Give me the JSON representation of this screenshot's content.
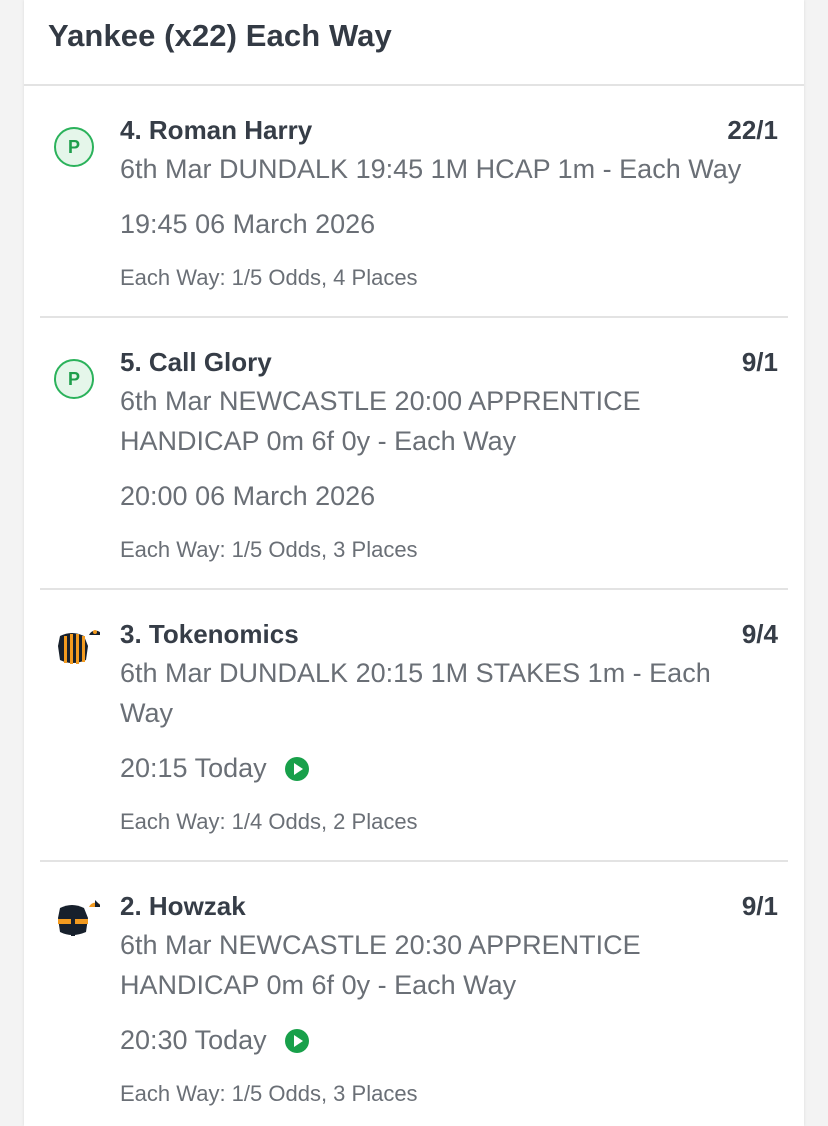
{
  "bet": {
    "title": "Yankee (x22) Each Way"
  },
  "selections": [
    {
      "runner": "4. Roman Harry",
      "odds": "22/1",
      "icon": "P",
      "event": "6th Mar DUNDALK 19:45 1M HCAP 1m - Each Way",
      "time": "19:45 06 March 2026",
      "terms": "Each Way: 1/5 Odds, 4 Places"
    },
    {
      "runner": "5. Call Glory",
      "odds": "9/1",
      "icon": "P",
      "event": "6th Mar NEWCASTLE 20:00 APPRENTICE HANDICAP 0m 6f 0y - Each Way",
      "time": "20:00 06 March 2026",
      "terms": "Each Way: 1/5 Odds, 3 Places"
    },
    {
      "runner": "3. Tokenomics",
      "odds": "9/4",
      "icon": "jockey-silks-icon",
      "event": "6th Mar DUNDALK 20:15 1M STAKES 1m - Each Way",
      "time": "20:15 Today",
      "terms": "Each Way: 1/4 Odds, 2 Places"
    },
    {
      "runner": "2. Howzak",
      "odds": "9/1",
      "icon": "jockey-silks-icon",
      "event": "6th Mar NEWCASTLE 20:30 APPRENTICE HANDICAP 0m 6f 0y - Each Way",
      "time": "20:30 Today",
      "terms": "Each Way: 1/5 Odds, 3 Places"
    }
  ],
  "colors": {
    "accent_green": "#18a04a",
    "badge_bg": "#e5f6ea",
    "text_dark": "#363d47",
    "text_grey": "#6a6f76",
    "silks_dark": "#17202c",
    "silks_orange": "#f29a1f"
  }
}
